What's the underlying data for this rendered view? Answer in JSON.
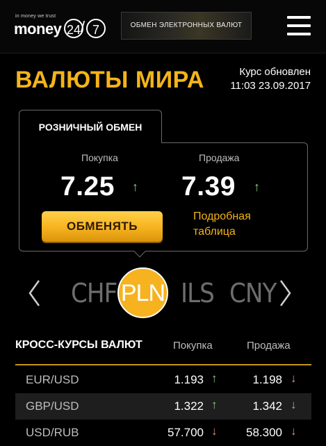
{
  "header": {
    "logo_tagline": "in money we trust",
    "logo_word": "money",
    "logo_num1": "24",
    "logo_num2": "7",
    "exchange_btn": "ОБМЕН ЭЛЕКТРОННЫХ ВАЛЮТ",
    "menu_icon": "hamburger-icon"
  },
  "title": "ВАЛЮТЫ МИРА",
  "updated": {
    "label": "Курс обновлен",
    "datetime": "11:03 23.09.2017"
  },
  "retail": {
    "tab_label": "РОЗНИЧНЫЙ ОБМЕН",
    "buy_label": "Покупка",
    "sell_label": "Продажа",
    "buy_value": "7.25",
    "sell_value": "7.39",
    "buy_trend": "up",
    "sell_trend": "up",
    "exchange_button": "ОБМЕНЯТЬ",
    "details_link_line1": "Подробная",
    "details_link_line2": "таблица"
  },
  "currency_selector": {
    "prev_icon": "chevron-left-icon",
    "next_icon": "chevron-right-icon",
    "items": [
      "CHF",
      "PLN",
      "ILS",
      "CNY"
    ],
    "active": "PLN"
  },
  "cross_rates": {
    "title": "КРОСС-КУРСЫ ВАЛЮТ",
    "col_buy": "Покупка",
    "col_sell": "Продажа",
    "rows": [
      {
        "pair": "EUR/USD",
        "buy": "1.193",
        "buy_trend": "up",
        "sell": "1.198",
        "sell_trend": "down"
      },
      {
        "pair": "GBP/USD",
        "buy": "1.322",
        "buy_trend": "up",
        "sell": "1.342",
        "sell_trend": "down"
      },
      {
        "pair": "USD/RUB",
        "buy": "57.700",
        "buy_trend": "down",
        "sell": "58.300",
        "sell_trend": "down"
      }
    ]
  },
  "colors": {
    "accent": "#f4b41a",
    "trend_up": "#8ad081",
    "trend_down": "#e9937a"
  }
}
